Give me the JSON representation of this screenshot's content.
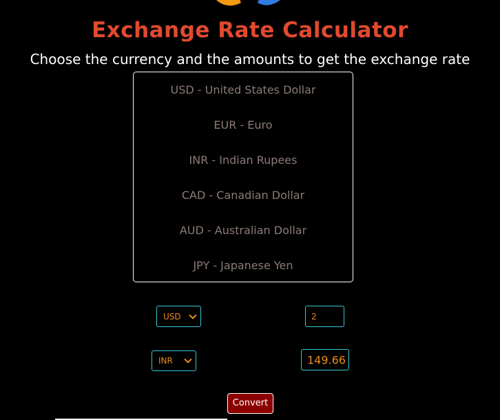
{
  "header": {
    "title": "Exchange Rate Calculator",
    "subtitle": "Choose the currency and the amounts to get the exchange rate"
  },
  "currencies": [
    "USD - United States Dollar",
    "EUR - Euro",
    "INR - Indian Rupees",
    "CAD - Canadian Dollar",
    "AUD - Australian Dollar",
    "JPY - Japanese Yen"
  ],
  "converter": {
    "from_currency": "USD",
    "from_amount": "2",
    "to_currency": "INR",
    "to_amount": "149.66",
    "convert_label": "Convert"
  },
  "colors": {
    "background": "#000000",
    "title": "#e04a2e",
    "accent_border": "#35c9d4",
    "value_text": "#f08a1c",
    "button": "#8b0000",
    "list_text": "#8b7b76"
  },
  "icons": {
    "logo": "app-logo-icon",
    "dropdown": "chevron-down-icon"
  }
}
